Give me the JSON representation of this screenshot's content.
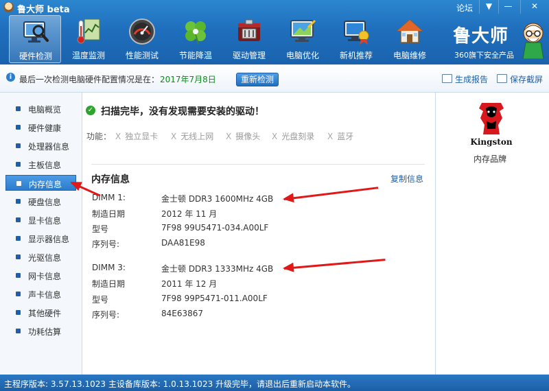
{
  "window": {
    "title": "鲁大师 beta",
    "forum_link": "论坛",
    "controls": {
      "dropdown": "▼",
      "minimize": "—",
      "close": "✕"
    }
  },
  "toolbar": {
    "items": [
      {
        "label": "硬件检测",
        "icon": "hardware-check-icon",
        "active": true
      },
      {
        "label": "温度监测",
        "icon": "thermometer-icon"
      },
      {
        "label": "性能测试",
        "icon": "speedometer-icon"
      },
      {
        "label": "节能降温",
        "icon": "clover-icon"
      },
      {
        "label": "驱动管理",
        "icon": "driver-chip-icon"
      },
      {
        "label": "电脑优化",
        "icon": "optimize-icon"
      },
      {
        "label": "新机推荐",
        "icon": "new-pc-icon"
      },
      {
        "label": "电脑维修",
        "icon": "repair-house-icon"
      }
    ]
  },
  "brand": {
    "name": "鲁大师",
    "subtitle": "360旗下安全产品"
  },
  "infobar": {
    "text": "最后一次检测电脑硬件配置情况是在：",
    "date": "2017年7月8日",
    "recheck_button": "重新检测",
    "report_link": "生成报告",
    "screenshot_link": "保存截屏"
  },
  "sidebar": {
    "items": [
      {
        "label": "电脑概览"
      },
      {
        "label": "硬件健康"
      },
      {
        "label": "处理器信息"
      },
      {
        "label": "主板信息"
      },
      {
        "label": "内存信息",
        "active": true
      },
      {
        "label": "硬盘信息"
      },
      {
        "label": "显卡信息"
      },
      {
        "label": "显示器信息"
      },
      {
        "label": "光驱信息"
      },
      {
        "label": "网卡信息"
      },
      {
        "label": "声卡信息"
      },
      {
        "label": "其他硬件"
      },
      {
        "label": "功耗估算"
      }
    ]
  },
  "main": {
    "scan_message": "扫描完毕，没有发现需要安装的驱动！",
    "function_label": "功能：",
    "functions": [
      "独立显卡",
      "无线上网",
      "摄像头",
      "光盘刻录",
      "蓝牙"
    ],
    "function_mark": "X",
    "section_title": "内存信息",
    "copy_link": "复制信息",
    "memory": [
      {
        "slot_label": "DIMM 1:",
        "slot_value": "金士顿 DDR3 1600MHz 4GB",
        "date_label": "制造日期",
        "date_value": "2012 年 11 月",
        "model_label": "型号",
        "model_value": "7F98 99U5471-034.A00LF",
        "serial_label": "序列号:",
        "serial_value": "DAA81E98"
      },
      {
        "slot_label": "DIMM 3:",
        "slot_value": "金士顿 DDR3 1333MHz 4GB",
        "date_label": "制造日期",
        "date_value": "2011 年 12 月",
        "model_label": "型号",
        "model_value": "7F98 99P5471-011.A00LF",
        "serial_label": "序列号:",
        "serial_value": "84E63867"
      }
    ]
  },
  "right_panel": {
    "logo_text": "Kingston",
    "caption": "内存品牌"
  },
  "statusbar": {
    "text": "主程序版本: 3.57.13.1023   主设备库版本: 1.0.13.1023   升级完毕，请退出后重新启动本软件。"
  },
  "colors": {
    "accent": "#1f6fbd",
    "date_green": "#0b8a1a",
    "link_blue": "#1e5fa8",
    "annotation_red": "#e01818"
  }
}
